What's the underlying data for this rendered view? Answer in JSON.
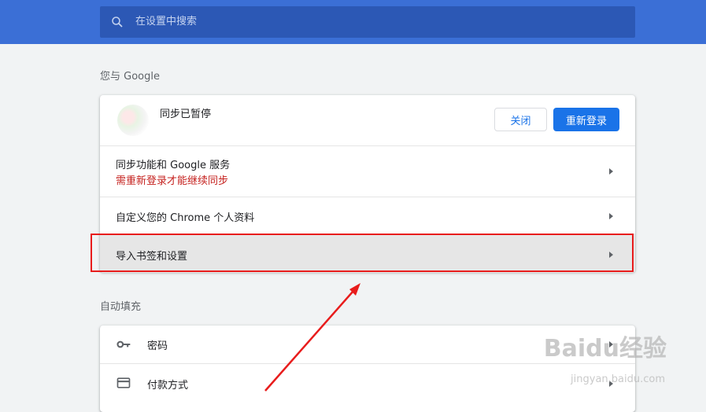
{
  "search": {
    "placeholder": "在设置中搜索"
  },
  "sections": {
    "you_and_google": "您与 Google",
    "autofill": "自动填充"
  },
  "account": {
    "status": "同步已暂停",
    "close_label": "关闭",
    "relogin_label": "重新登录"
  },
  "rows": {
    "sync_title": "同步功能和 Google 服务",
    "sync_warning": "需重新登录才能继续同步",
    "customize_profile": "自定义您的 Chrome 个人资料",
    "import_bookmarks": "导入书签和设置"
  },
  "autofill": {
    "passwords": "密码",
    "payment_methods": "付款方式"
  },
  "watermark": {
    "logo": "Baidu经验",
    "url": "jingyan.baidu.com"
  },
  "colors": {
    "header_blue": "#3b6fd6",
    "search_blue": "#2c58b5",
    "primary_button": "#1a73e8",
    "warning_red": "#c5221f",
    "annotation_red": "#e81c1c"
  }
}
